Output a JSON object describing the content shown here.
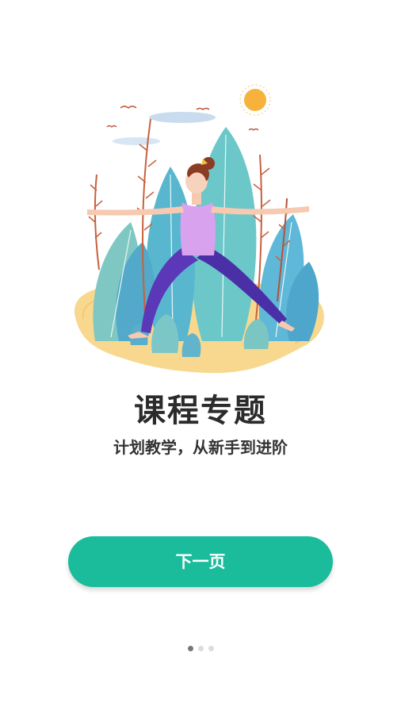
{
  "onboarding": {
    "title": "课程专题",
    "subtitle": "计划教学，从新手到进阶",
    "next_button_label": "下一页",
    "page_count": 3,
    "current_page": 1,
    "illustration": "yoga-warrior-pose-illustration"
  },
  "colors": {
    "button": "#1abc9c",
    "title": "#2b2b2b",
    "dot_active": "#777777",
    "dot_inactive": "#dcdcdc"
  }
}
